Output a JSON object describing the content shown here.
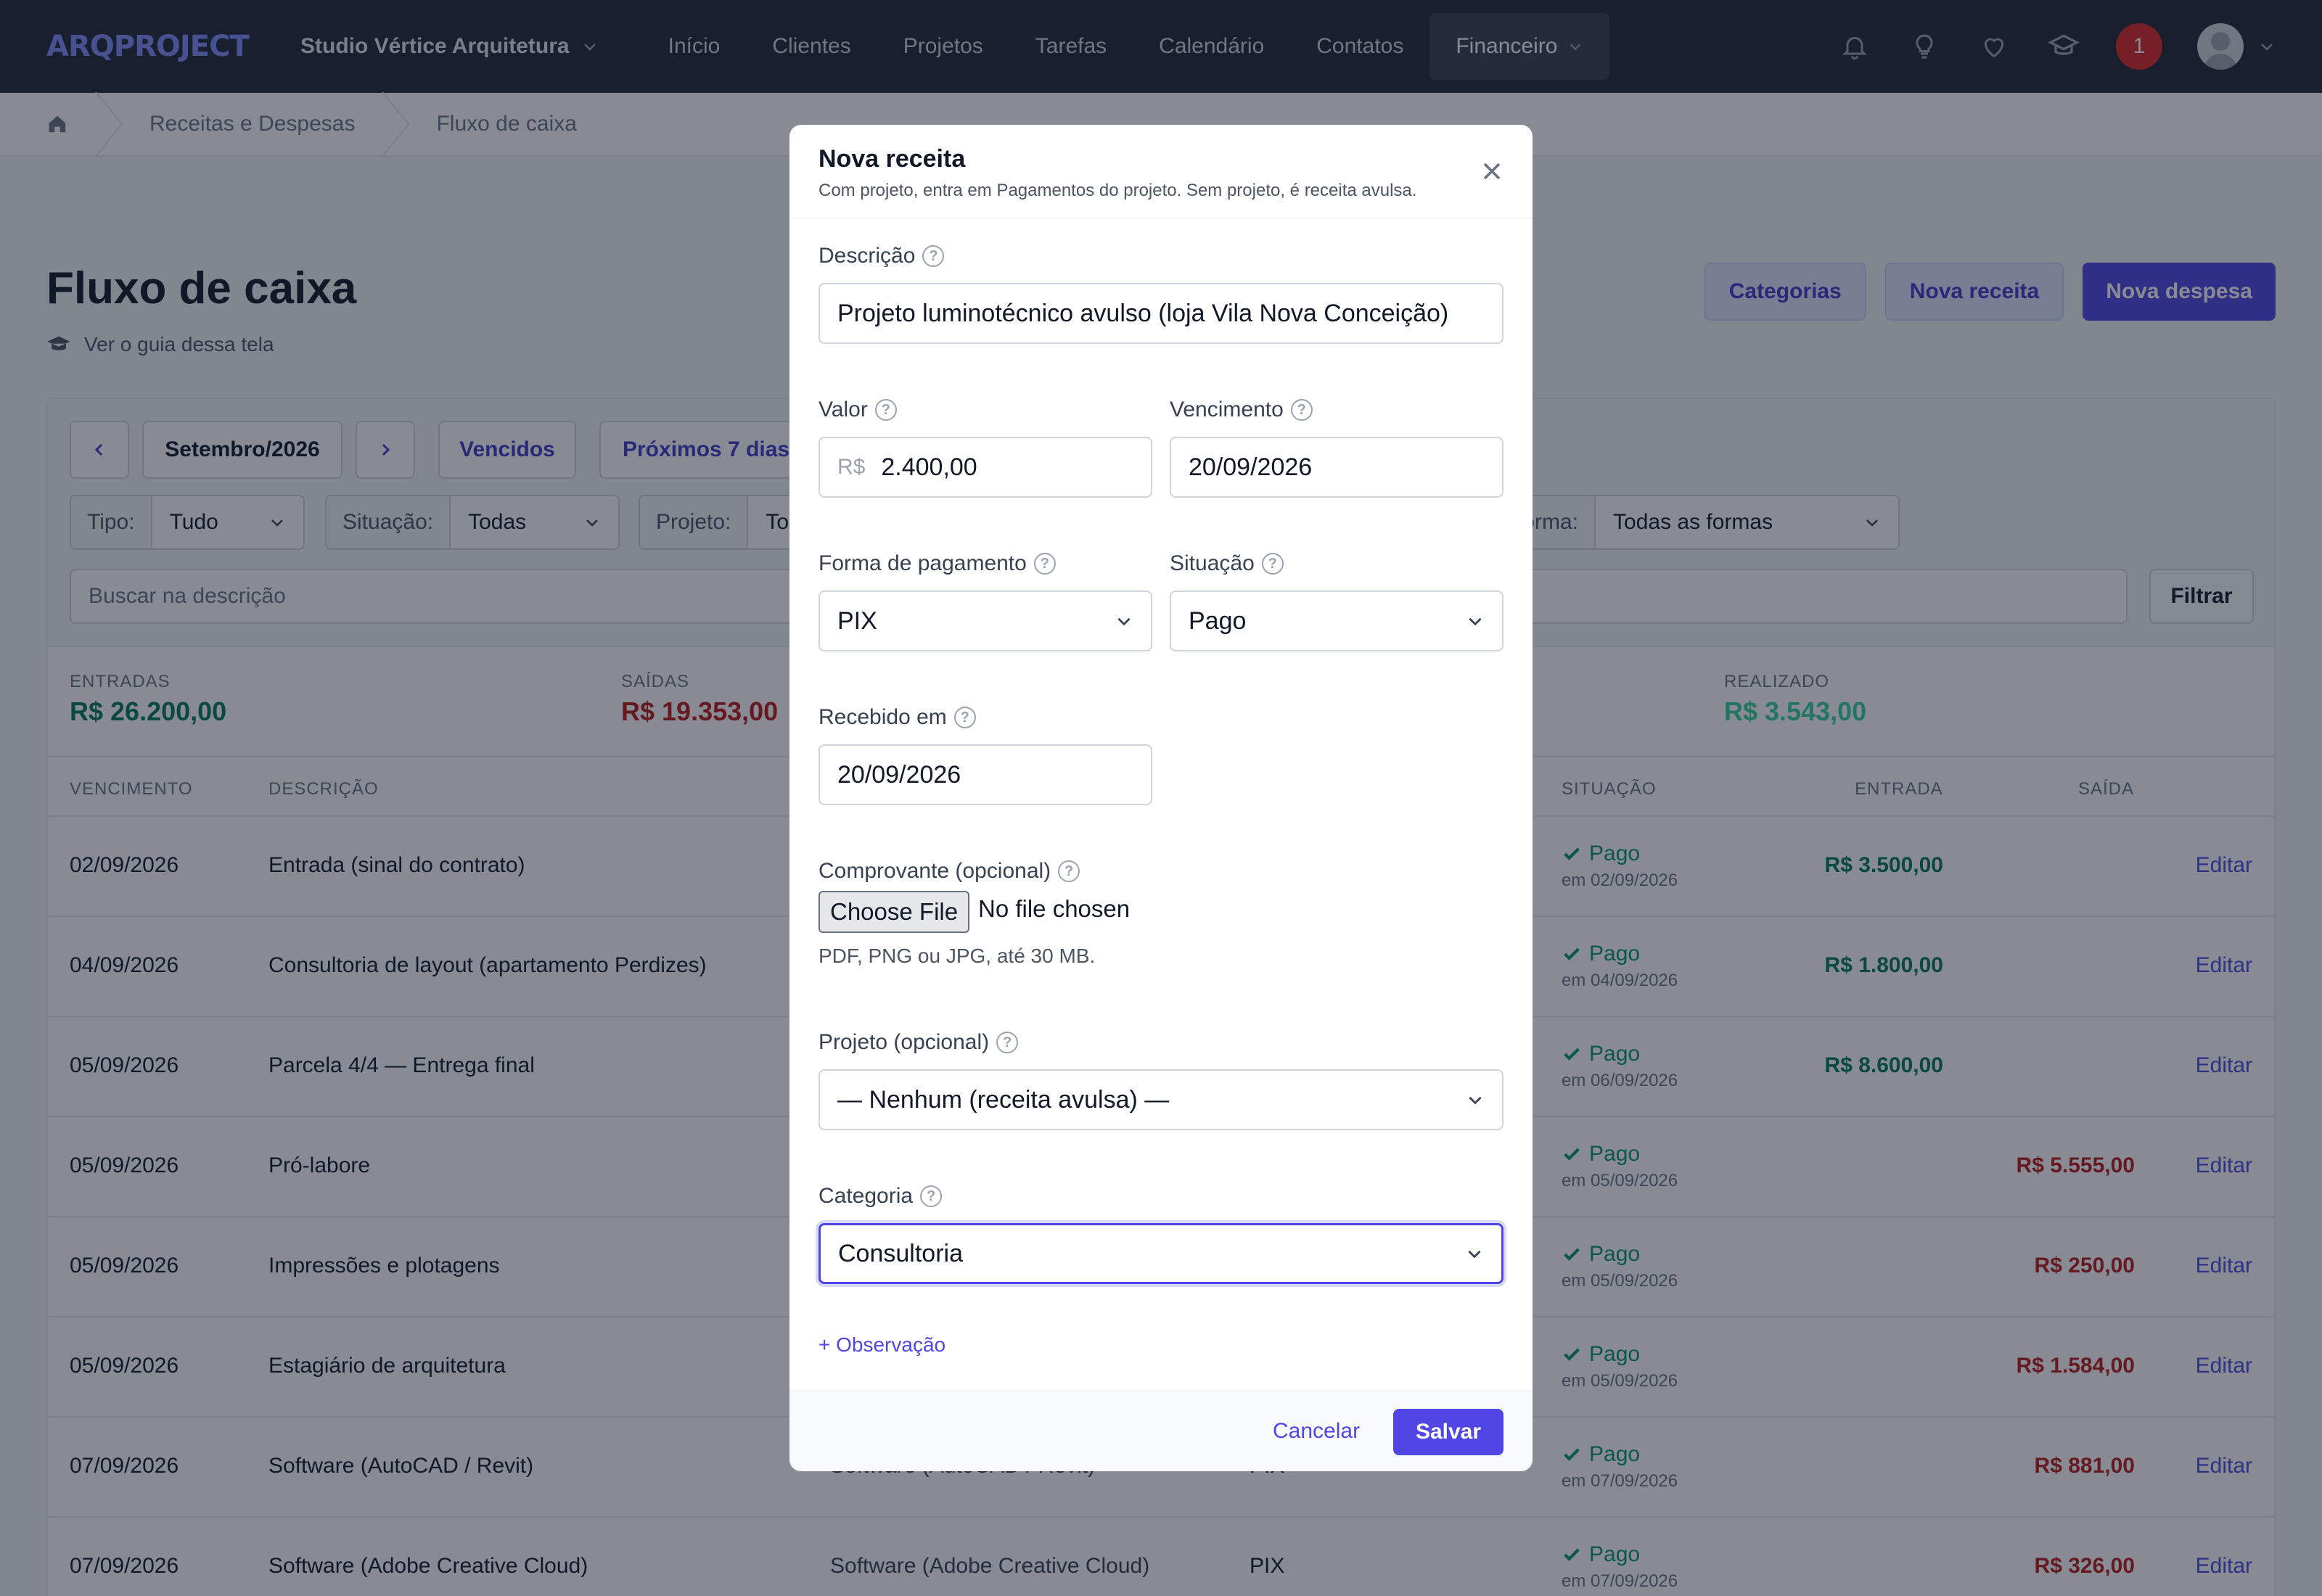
{
  "nav": {
    "logo": "ARQPROJECT",
    "studio": "Studio Vértice Arquitetura",
    "links": [
      "Início",
      "Clientes",
      "Projetos",
      "Tarefas",
      "Calendário",
      "Contatos"
    ],
    "active": "Financeiro",
    "badge": "1"
  },
  "breadcrumb": [
    "Receitas e Despesas",
    "Fluxo de caixa"
  ],
  "page": {
    "title": "Fluxo de caixa",
    "guide": "Ver o guia dessa tela",
    "actions": {
      "categorias": "Categorias",
      "nova_receita": "Nova receita",
      "nova_despesa": "Nova despesa"
    }
  },
  "filters": {
    "month": "Setembro/2026",
    "vencidos": "Vencidos",
    "proximos": "Próximos 7 dias",
    "tipo_label": "Tipo:",
    "tipo_val": "Tudo",
    "situacao_label": "Situação:",
    "situacao_val": "Todas",
    "projeto_label": "Projeto:",
    "projeto_val": "To",
    "forma_label": "Forma:",
    "forma_val": "Todas as formas",
    "search_placeholder": "Buscar na descrição",
    "filtrar": "Filtrar"
  },
  "summary": {
    "entradas_label": "ENTRADAS",
    "entradas": "R$ 26.200,00",
    "saidas_label": "SAÍDAS",
    "saidas": "R$ 19.353,00",
    "realizado_label": "REALIZADO",
    "realizado": "R$ 3.543,00"
  },
  "table": {
    "headers": {
      "vencimento": "VENCIMENTO",
      "descricao": "DESCRIÇÃO",
      "situacao": "SITUAÇÃO",
      "entrada": "ENTRADA",
      "saida": "SAÍDA"
    },
    "rows": [
      {
        "date": "02/09/2026",
        "desc": "Entrada (sinal do contrato)",
        "cat": "",
        "forma": "",
        "status": "Pago",
        "paid": "em 02/09/2026",
        "in": "R$ 3.500,00",
        "out": "",
        "edit": "Editar"
      },
      {
        "date": "04/09/2026",
        "desc": "Consultoria de layout (apartamento Perdizes)",
        "cat": "",
        "forma": "",
        "status": "Pago",
        "paid": "em 04/09/2026",
        "in": "R$ 1.800,00",
        "out": "",
        "edit": "Editar"
      },
      {
        "date": "05/09/2026",
        "desc": "Parcela 4/4 — Entrega final",
        "cat": "",
        "forma": "",
        "status": "Pago",
        "paid": "em 06/09/2026",
        "in": "R$ 8.600,00",
        "out": "",
        "edit": "Editar"
      },
      {
        "date": "05/09/2026",
        "desc": "Pró-labore",
        "cat": "",
        "forma": "",
        "status": "Pago",
        "paid": "em 05/09/2026",
        "in": "",
        "out": "R$ 5.555,00",
        "edit": "Editar"
      },
      {
        "date": "05/09/2026",
        "desc": "Impressões e plotagens",
        "cat": "",
        "forma": "",
        "status": "Pago",
        "paid": "em 05/09/2026",
        "in": "",
        "out": "R$ 250,00",
        "edit": "Editar"
      },
      {
        "date": "05/09/2026",
        "desc": "Estagiário de arquitetura",
        "cat": "",
        "forma": "",
        "status": "Pago",
        "paid": "em 05/09/2026",
        "in": "",
        "out": "R$ 1.584,00",
        "edit": "Editar"
      },
      {
        "date": "07/09/2026",
        "desc": "Software (AutoCAD / Revit)",
        "cat": "Software (AutoCAD / Revit)",
        "forma": "PIX",
        "status": "Pago",
        "paid": "em 07/09/2026",
        "in": "",
        "out": "R$ 881,00",
        "edit": "Editar"
      },
      {
        "date": "07/09/2026",
        "desc": "Software (Adobe Creative Cloud)",
        "cat": "Software (Adobe Creative Cloud)",
        "forma": "PIX",
        "status": "Pago",
        "paid": "em 07/09/2026",
        "in": "",
        "out": "R$ 326,00",
        "edit": "Editar"
      }
    ]
  },
  "modal": {
    "title": "Nova receita",
    "subtitle": "Com projeto, entra em Pagamentos do projeto. Sem projeto, é receita avulsa.",
    "descricao_label": "Descrição",
    "descricao": "Projeto luminotécnico avulso (loja Vila Nova Conceição)",
    "valor_label": "Valor",
    "valor_prefix": "R$",
    "valor": "2.400,00",
    "vencimento_label": "Vencimento",
    "vencimento": "20/09/2026",
    "forma_label": "Forma de pagamento",
    "forma": "PIX",
    "situacao_label": "Situação",
    "situacao": "Pago",
    "recebido_label": "Recebido em",
    "recebido": "20/09/2026",
    "comprovante_label": "Comprovante (opcional)",
    "choose_file": "Choose File",
    "no_file": "No file chosen",
    "file_hint": "PDF, PNG ou JPG, até 30 MB.",
    "projeto_label": "Projeto (opcional)",
    "projeto": "— Nenhum (receita avulsa) —",
    "categoria_label": "Categoria",
    "categoria": "Consultoria",
    "observacao": "+ Observação",
    "cancel": "Cancelar",
    "save": "Salvar"
  }
}
